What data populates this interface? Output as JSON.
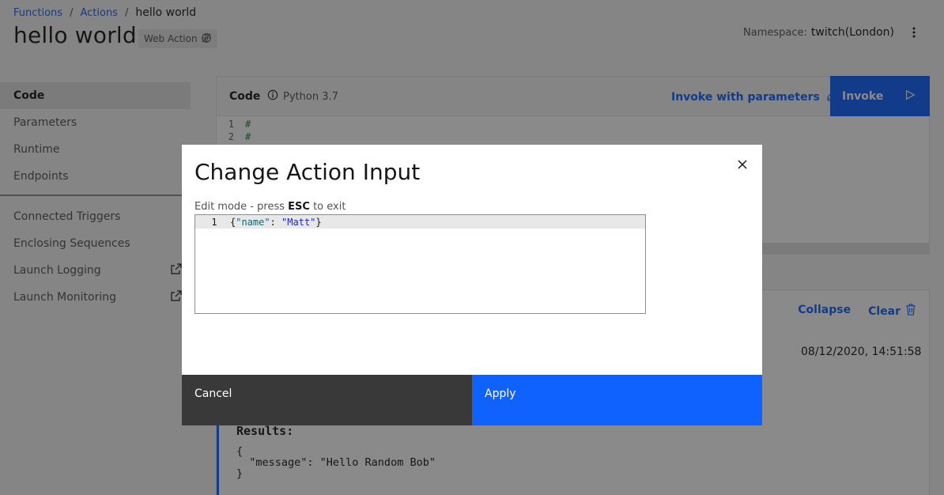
{
  "breadcrumb": {
    "items": [
      "Functions",
      "Actions"
    ],
    "separator": "/",
    "current": "hello world"
  },
  "page": {
    "title": "hello world",
    "tag": "Web Action"
  },
  "namespace": {
    "label": "Namespace:",
    "value": "twitch(London)"
  },
  "sidenav": {
    "primary": [
      {
        "label": "Code",
        "active": true
      },
      {
        "label": "Parameters"
      },
      {
        "label": "Runtime"
      },
      {
        "label": "Endpoints"
      }
    ],
    "secondary": [
      {
        "label": "Connected Triggers"
      },
      {
        "label": "Enclosing Sequences"
      },
      {
        "label": "Launch Logging",
        "external": true
      },
      {
        "label": "Launch Monitoring",
        "external": true
      }
    ]
  },
  "code_panel": {
    "label": "Code",
    "runtime": "Python 3.7",
    "invoke_with_params": "Invoke with parameters",
    "invoke": "Invoke",
    "lines": [
      {
        "num": "1",
        "text": "#"
      },
      {
        "num": "2",
        "text": "#"
      }
    ]
  },
  "output_panel": {
    "collapse": "Collapse",
    "clear": "Clear",
    "timestamp": "08/12/2020, 14:51:58",
    "results_title": "Results:",
    "results_json": "{\n  \"message\": \"Hello Random Bob\"\n}"
  },
  "modal": {
    "title": "Change Action Input",
    "helper_prefix": "Edit mode - press",
    "helper_key": "ESC",
    "helper_suffix": "to exit",
    "editor_line_num": "1",
    "editor_tokens": {
      "open": "{",
      "key": "\"name\"",
      "colon": ": ",
      "value": "\"Matt\"",
      "close": "}"
    },
    "cancel": "Cancel",
    "apply": "Apply"
  },
  "colors": {
    "primary": "#0f62fe",
    "overlay": "rgba(22,22,22,0.5)",
    "cancel_bg": "#393939"
  }
}
